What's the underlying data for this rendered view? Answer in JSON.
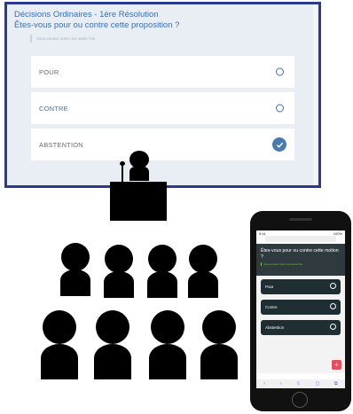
{
  "screen": {
    "title": "Décisions Ordinaires - 1ère Résolution",
    "question": "Êtes-vous pour ou contre cette proposition ?",
    "hint": "Vous pouvez voter une seule fois",
    "options": [
      {
        "label": "POUR",
        "selected": false
      },
      {
        "label": "CONTRE",
        "selected": false
      },
      {
        "label": "ABSTENTION",
        "selected": true
      }
    ],
    "colors": {
      "frame": "#2b3a8f",
      "background": "#e8eef4",
      "accent": "#3a6fb0"
    }
  },
  "phone": {
    "status_time": "9:41",
    "status_right": "100%",
    "url": "",
    "question": "Êtes-vous pour ou contre cette motion ?",
    "hint": "Vous pouvez voter une seule fois",
    "options": [
      {
        "label": "Pour"
      },
      {
        "label": "Contre"
      },
      {
        "label": "Abstention"
      }
    ],
    "fab_icon": "+",
    "toolbar": [
      "‹",
      "›",
      "⇪",
      "▢",
      "⧉"
    ],
    "colors": {
      "header": "#2f3a3e",
      "option": "#1f2e33",
      "hint": "#7fc24a",
      "fab": "#e0515f"
    }
  }
}
